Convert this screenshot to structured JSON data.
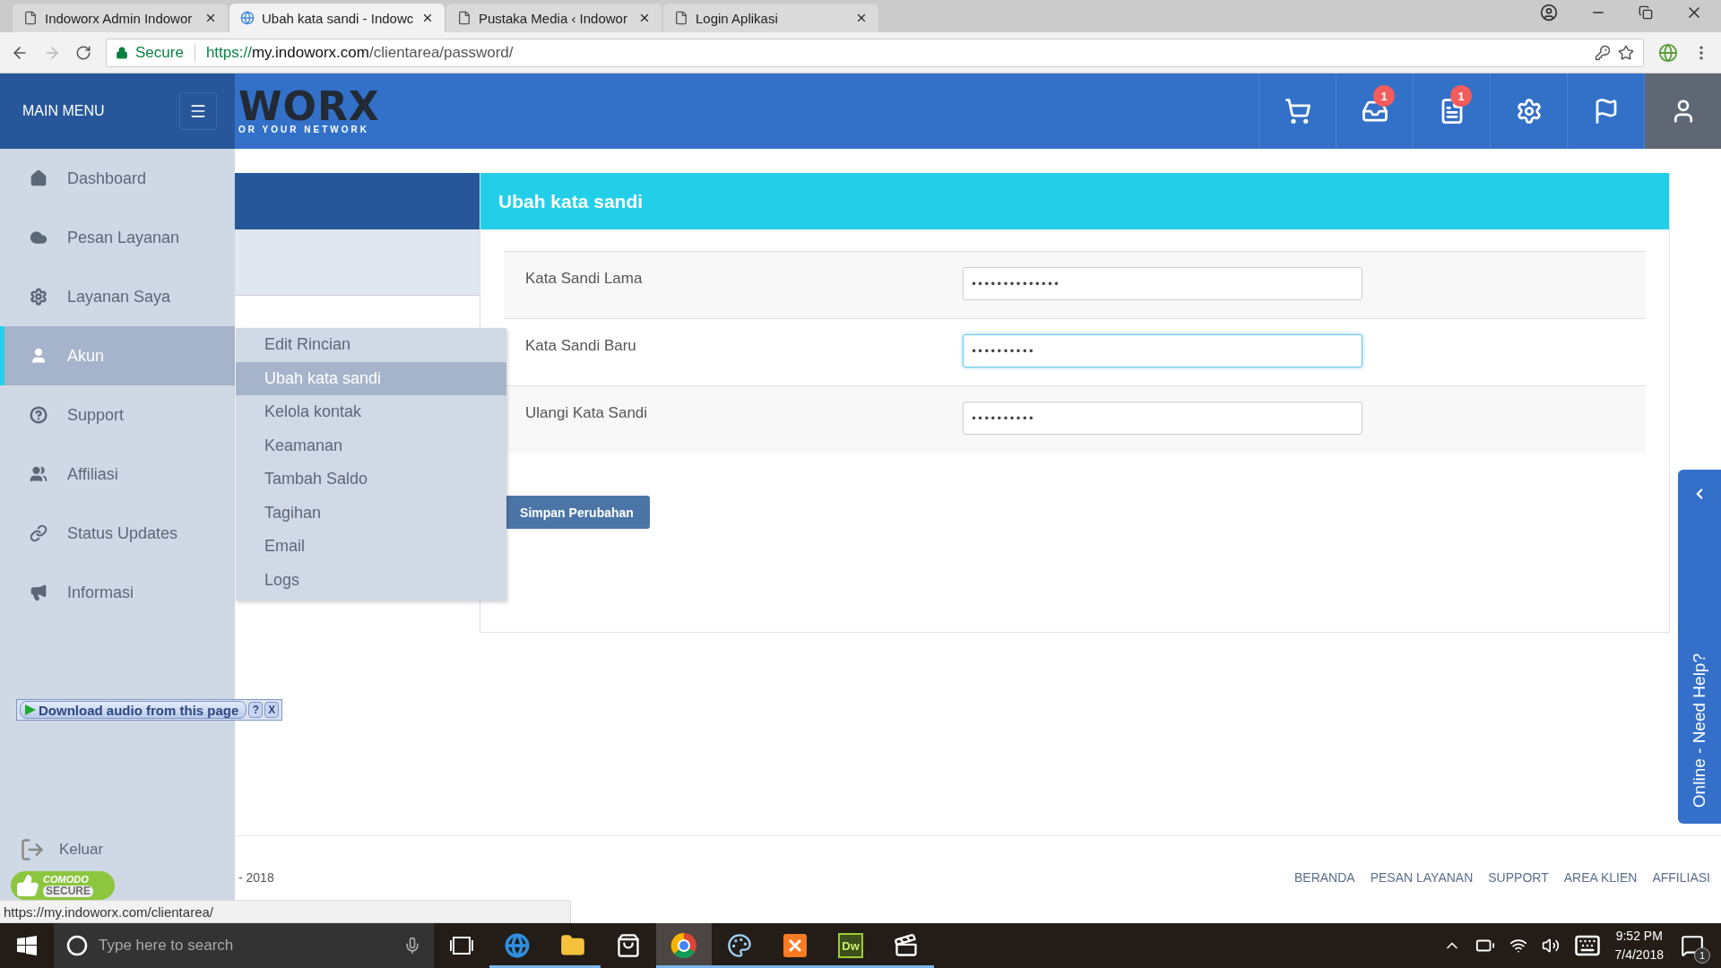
{
  "browser": {
    "tabs": [
      {
        "title": "Indoworx Admin Indowor",
        "selected": false
      },
      {
        "title": "Ubah kata sandi - Indowc",
        "selected": true
      },
      {
        "title": "Pustaka Media ‹ Indowor",
        "selected": false
      },
      {
        "title": "Login Aplikasi",
        "selected": false
      }
    ],
    "address": {
      "secure_label": "Secure",
      "scheme": "https://",
      "host": "my.indoworx.com",
      "path": "/clientarea/password/"
    }
  },
  "header": {
    "main_menu_label": "MAIN MENU",
    "logo_text": "WORX",
    "logo_tagline": "OR YOUR NETWORK",
    "icons": [
      {
        "selected": false
      },
      {
        "badge": "1",
        "selected": false
      },
      {
        "badge": "1",
        "selected": false
      },
      {
        "selected": false
      },
      {
        "selected": false
      },
      {
        "selected": true
      }
    ]
  },
  "sidebar": {
    "items": [
      {
        "label": "Dashboard",
        "selected": false
      },
      {
        "label": "Pesan Layanan",
        "selected": false
      },
      {
        "label": "Layanan Saya",
        "selected": false
      },
      {
        "label": "Akun",
        "selected": true
      },
      {
        "label": "Support",
        "selected": false
      },
      {
        "label": "Affiliasi",
        "selected": false
      },
      {
        "label": "Status Updates",
        "selected": false
      },
      {
        "label": "Informasi",
        "selected": false
      }
    ],
    "logout_label": "Keluar"
  },
  "submenu": [
    {
      "label": "Edit Rincian",
      "selected": false
    },
    {
      "label": "Ubah kata sandi",
      "selected": true
    },
    {
      "label": "Kelola kontak",
      "selected": false
    },
    {
      "label": "Keamanan",
      "selected": false
    },
    {
      "label": "Tambah Saldo",
      "selected": false
    },
    {
      "label": "Tagihan",
      "selected": false
    },
    {
      "label": "Email",
      "selected": false
    },
    {
      "label": "Logs",
      "selected": false
    }
  ],
  "panel": {
    "title": "Ubah kata sandi",
    "fields": [
      {
        "label": "Kata Sandi Lama",
        "value": "••••••••••••••",
        "focused": false
      },
      {
        "label": "Kata Sandi Baru",
        "value": "••••••••••",
        "focused": true
      },
      {
        "label": "Ulangi Kata Sandi",
        "value": "••••••••••",
        "focused": false
      }
    ],
    "submit": "Simpan Perubahan"
  },
  "help_tab": {
    "label": "Online - Need Help?"
  },
  "audio_bar": {
    "label": "Download audio from this page",
    "help": "?",
    "close": "X"
  },
  "comodo_badge": {
    "line_1": "COMODO",
    "line_2": "SECURE"
  },
  "footer": {
    "copyright": "- 2018",
    "links": [
      "BERANDA",
      "PESAN LAYANAN",
      "SUPPORT",
      "AREA KLIEN",
      "AFFILIASI"
    ]
  },
  "status_url": "https://my.indoworx.com/clientarea/",
  "taskbar": {
    "search_placeholder": "Type here to search",
    "apps": [
      {
        "kind": "edge",
        "running": true,
        "active": false
      },
      {
        "kind": "explorer",
        "running": true,
        "active": false
      },
      {
        "kind": "store",
        "running": false,
        "active": false
      },
      {
        "kind": "chrome",
        "running": true,
        "active": true
      },
      {
        "kind": "paint",
        "running": true,
        "active": false
      },
      {
        "kind": "xampp",
        "running": true,
        "active": false
      },
      {
        "kind": "dreamweaver",
        "label": "Dw",
        "running": true,
        "active": false
      },
      {
        "kind": "clapper",
        "running": true,
        "active": false
      }
    ],
    "time": "9:52 PM",
    "date": "7/4/2018",
    "notifications": "1"
  }
}
